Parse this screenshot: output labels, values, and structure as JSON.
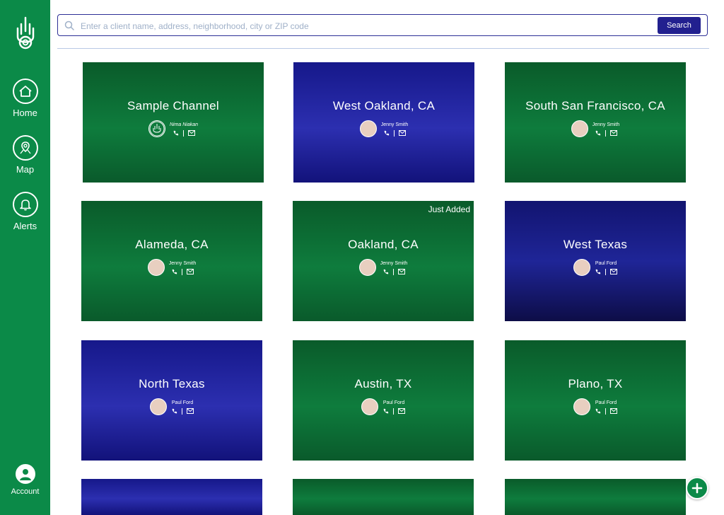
{
  "nav": [
    {
      "label": "Home",
      "icon": "home-icon"
    },
    {
      "label": "Map",
      "icon": "map-pin-icon"
    },
    {
      "label": "Alerts",
      "icon": "bell-icon"
    },
    {
      "label": "Account",
      "icon": "user-icon"
    }
  ],
  "search": {
    "placeholder": "Enter a client name, address, neighborhood, city or ZIP code",
    "button_label": "Search"
  },
  "channels": [
    {
      "title": "Sample Channel",
      "owner": "Nima Niakan",
      "theme": "green"
    },
    {
      "title": "West Oakland, CA",
      "owner": "Jenny Smith",
      "theme": "blue"
    },
    {
      "title": "South San Francisco, CA",
      "owner": "Jenny Smith",
      "theme": "green"
    },
    {
      "title": "Alameda, CA",
      "owner": "Jenny Smith",
      "theme": "green"
    },
    {
      "title": "Oakland, CA",
      "owner": "Jenny Smith",
      "theme": "green",
      "badge": "Just Added"
    },
    {
      "title": "West Texas",
      "owner": "Paul Ford",
      "theme": "night"
    },
    {
      "title": "North Texas",
      "owner": "Paul Ford",
      "theme": "blue"
    },
    {
      "title": "Austin, TX",
      "owner": "Paul Ford",
      "theme": "green"
    },
    {
      "title": "Plano, TX",
      "owner": "Paul Ford",
      "theme": "green"
    }
  ],
  "colors": {
    "sidebar": "#0b8a48",
    "search_button": "#22208f",
    "card_green": "#0e7c3d",
    "card_blue": "#2c2fb0"
  },
  "fab_icon": "plus-icon"
}
